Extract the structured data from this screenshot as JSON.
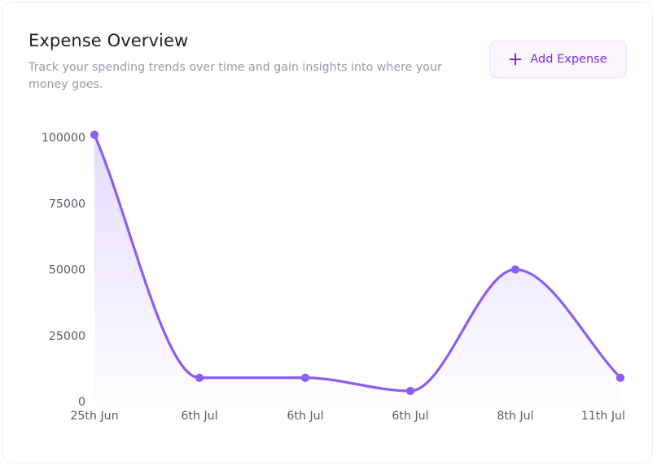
{
  "header": {
    "title": "Expense Overview",
    "subtitle": "Track your spending trends over time and gain insights into where your money goes.",
    "add_button_label": "Add Expense"
  },
  "colors": {
    "accent": "#8b5cf6",
    "button_text": "#7c2dd6",
    "button_bg": "#faf5ff"
  },
  "chart_data": {
    "type": "area",
    "title": "",
    "xlabel": "",
    "ylabel": "",
    "categories": [
      "25th Jun",
      "6th Jul",
      "6th Jul",
      "6th Jul",
      "8th Jul",
      "11th Jul"
    ],
    "series": [
      {
        "values": [
          101000,
          9000,
          9000,
          4000,
          50000,
          9000
        ]
      }
    ],
    "yticks": [
      0,
      25000,
      50000,
      75000,
      100000
    ],
    "ylim": [
      0,
      100000
    ],
    "grid": false,
    "legend": "none",
    "curve": "smooth"
  }
}
